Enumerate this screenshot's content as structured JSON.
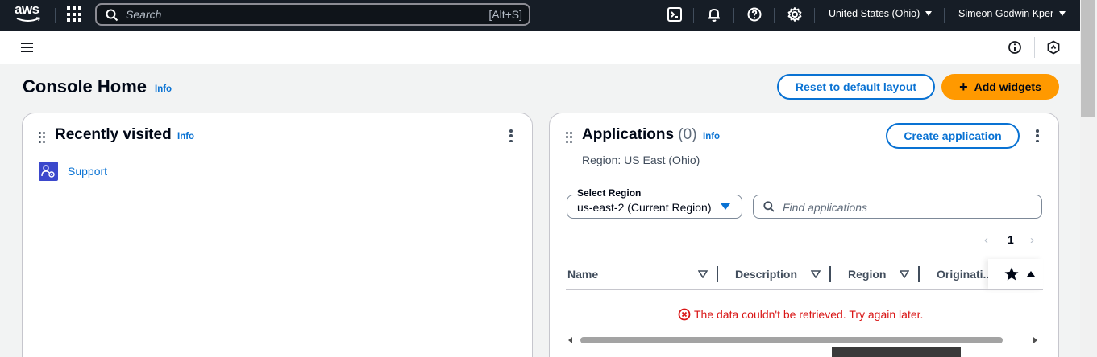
{
  "topnav": {
    "logo_text": "aws",
    "search": {
      "placeholder": "Search",
      "shortcut": "[Alt+S]"
    },
    "icons": [
      "cloudshell-icon",
      "bell-icon",
      "help-icon",
      "settings-icon"
    ],
    "region": "United States (Ohio)",
    "user": "Simeon Godwin Kper"
  },
  "page": {
    "title": "Console Home",
    "info": "Info",
    "reset_label": "Reset to default layout",
    "add_widgets_label": "Add widgets",
    "add_widgets_plus": "+"
  },
  "recently_visited": {
    "title": "Recently visited",
    "info": "Info",
    "items": [
      {
        "label": "Support",
        "icon": "support-icon"
      }
    ]
  },
  "applications": {
    "title": "Applications",
    "count": "(0)",
    "info": "Info",
    "create_label": "Create application",
    "region_text": "Region: US East (Ohio)",
    "select_region_label": "Select Region",
    "select_region_value": "us-east-2 (Current Region)",
    "find_placeholder": "Find applications",
    "pager": {
      "prev": "‹",
      "page": "1",
      "next": "›"
    },
    "columns": [
      "Name",
      "Description",
      "Region",
      "Originati..."
    ],
    "error": "The data couldn't be retrieved. Try again later."
  },
  "colors": {
    "nav_bg": "#161d26",
    "link": "#0972d3",
    "primary": "#ff9900",
    "error": "#d91515"
  }
}
